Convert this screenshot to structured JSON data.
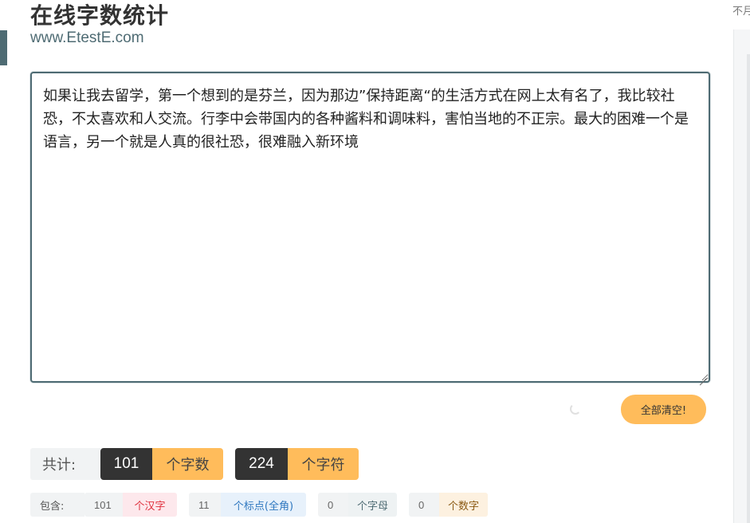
{
  "header": {
    "title": "在线字数统计",
    "subtitle": "www.EtestE.com"
  },
  "editor": {
    "text": "如果让我去留学，第一个想到的是芬兰，因为那边”保持距离“的生活方式在网上太有名了，我比较社恐，不太喜欢和人交流。行李中会带国内的各种酱料和调味料，害怕当地的不正宗。最大的困难一个是语言，另一个就是人真的很社恐，很难融入新环境"
  },
  "actions": {
    "clear_label": "全部清空!"
  },
  "totals": {
    "label": "共计:",
    "word_count": "101",
    "word_unit": "个字数",
    "char_count": "224",
    "char_unit": "个字符"
  },
  "details": {
    "label": "包含:",
    "hanzi_count": "101",
    "hanzi_unit": "个汉字",
    "punct_count": "11",
    "punct_unit": "个标点(全角)",
    "letter_count": "0",
    "letter_unit": "个字母",
    "digit_count": "0",
    "digit_unit": "个数字"
  },
  "sidebar": {
    "top_text": "不月"
  },
  "colors": {
    "accent": "#4e6b73",
    "button": "#ffbc5b",
    "dark_badge": "#333333"
  }
}
